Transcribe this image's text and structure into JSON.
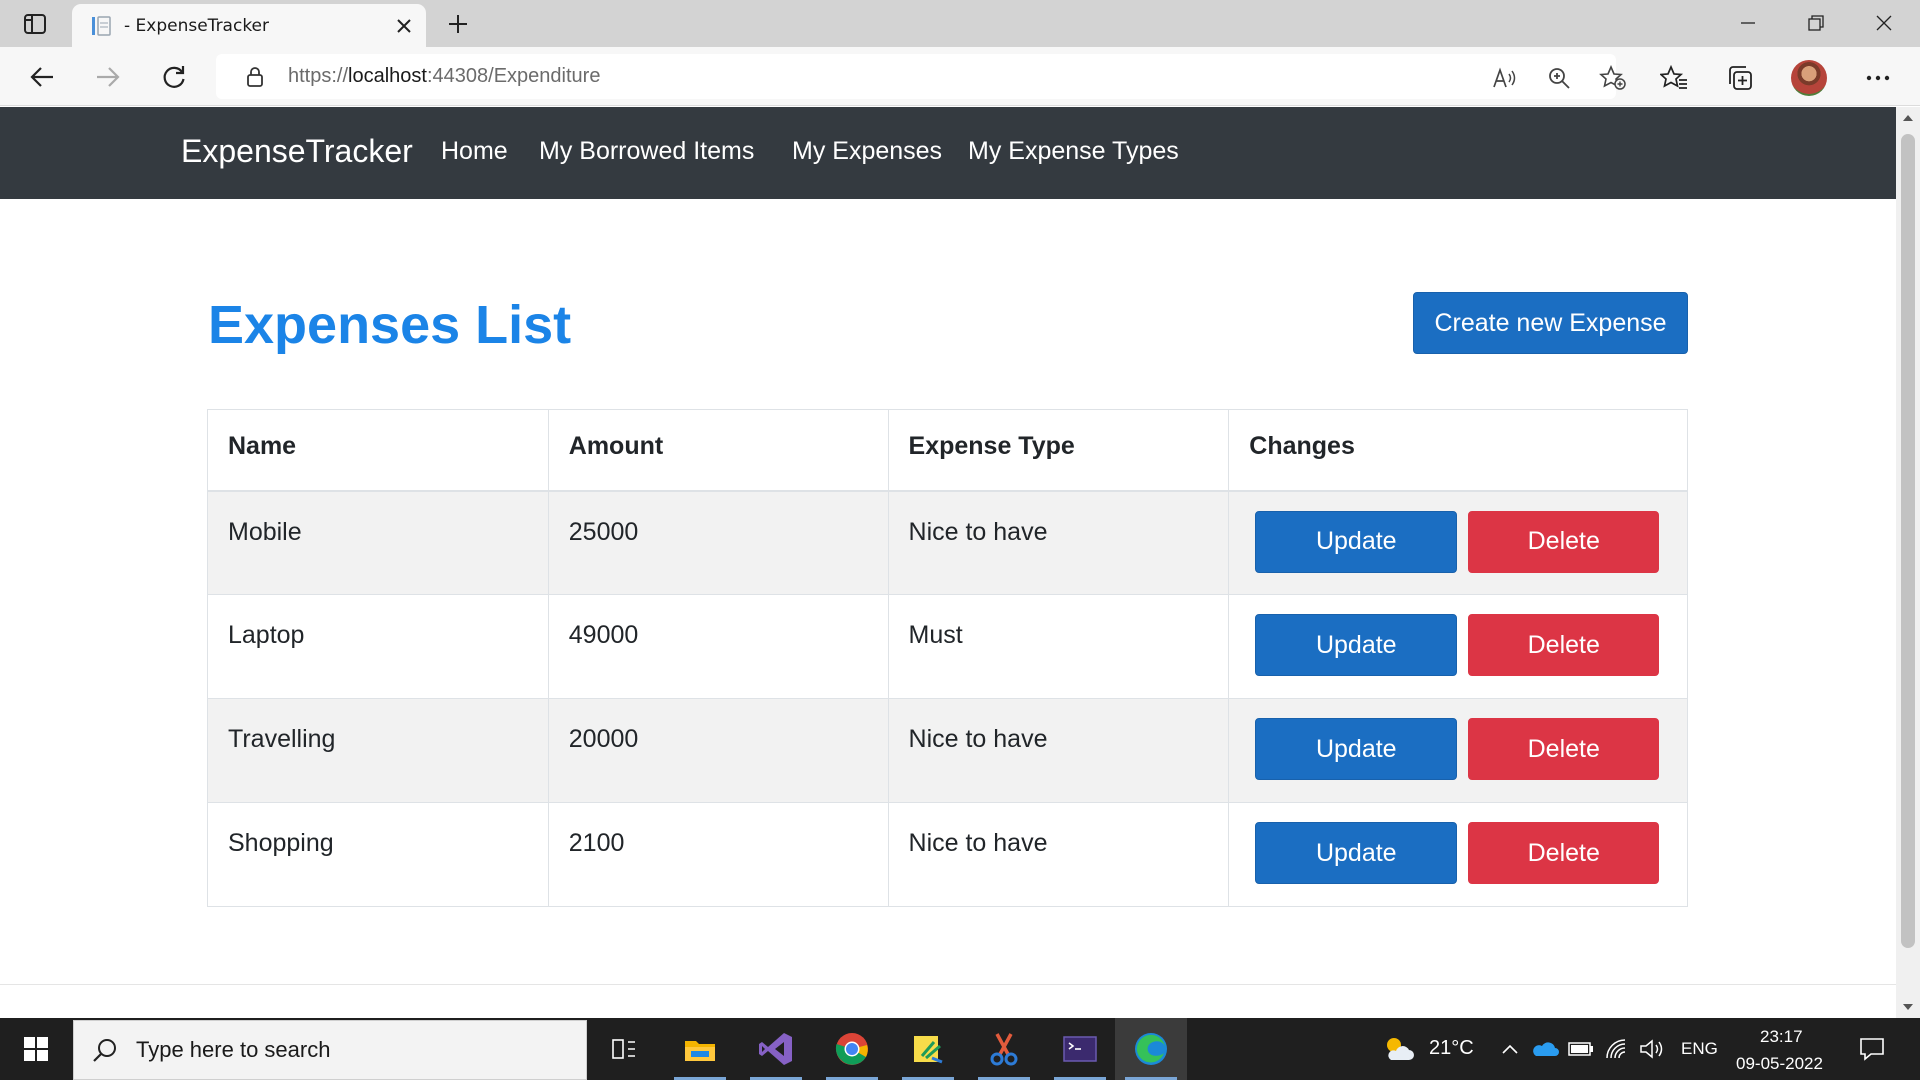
{
  "browser": {
    "tab_title": "- ExpenseTracker",
    "url_prefix": "https://",
    "url_host": "localhost",
    "url_rest": ":44308/Expenditure"
  },
  "app": {
    "brand": "ExpenseTracker",
    "nav": [
      "Home",
      "My Borrowed Items",
      "My Expenses",
      "My Expense Types"
    ],
    "heading": "Expenses List",
    "create_button": "Create new Expense",
    "table": {
      "columns": [
        "Name",
        "Amount",
        "Expense Type",
        "Changes"
      ],
      "rows": [
        {
          "name": "Mobile",
          "amount": "25000",
          "type": "Nice to have",
          "update": "Update",
          "delete": "Delete"
        },
        {
          "name": "Laptop",
          "amount": "49000",
          "type": "Must",
          "update": "Update",
          "delete": "Delete"
        },
        {
          "name": "Travelling",
          "amount": "20000",
          "type": "Nice to have",
          "update": "Update",
          "delete": "Delete"
        },
        {
          "name": "Shopping",
          "amount": "2100",
          "type": "Nice to have",
          "update": "Update",
          "delete": "Delete"
        }
      ]
    }
  },
  "taskbar": {
    "search_placeholder": "Type here to search",
    "temperature": "21°C",
    "language": "ENG",
    "time": "23:17",
    "date": "09-05-2022"
  },
  "colors": {
    "navbar": "#343a40",
    "heading": "#1b84e7",
    "primary_button": "#1b6ec2",
    "danger_button": "#dc3545"
  }
}
